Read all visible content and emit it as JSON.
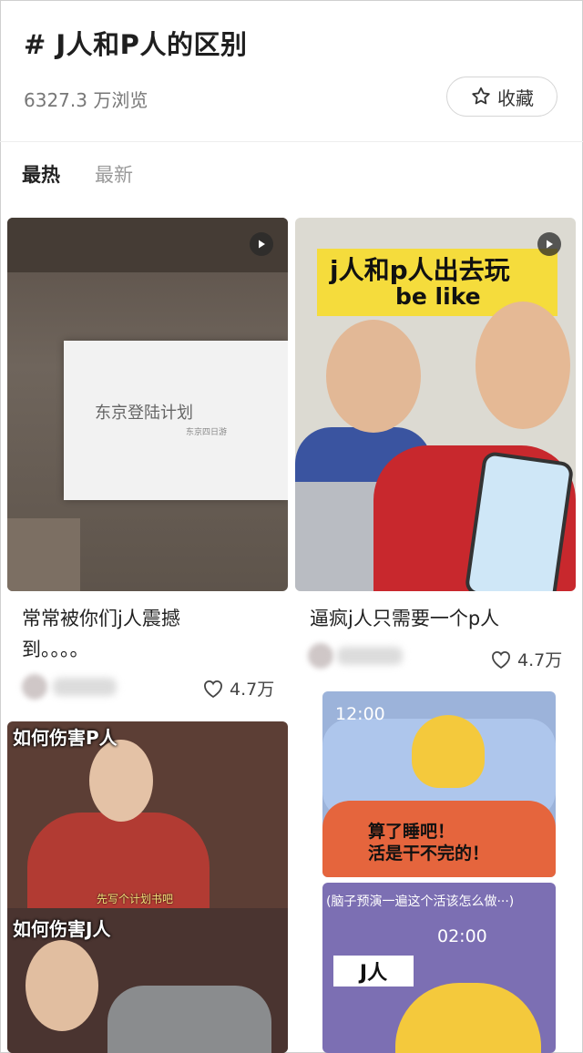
{
  "header": {
    "topic_title": "# J人和P人的区别",
    "views": "6327.3 万浏览",
    "favorite_label": "收藏"
  },
  "tabs": [
    {
      "label": "最热",
      "active": true
    },
    {
      "label": "最新",
      "active": false
    }
  ],
  "cards": [
    {
      "title": "常常被你们j人震撼到。。。。",
      "title_line1": "常常被你们j人震撼",
      "title_line2": "到。。。。",
      "likes": "4.7万",
      "media": {
        "type": "video",
        "screen_title": "东京登陆计划",
        "screen_subtitle": "东京四日游"
      }
    },
    {
      "title": "逼疯j人只需要一个p人",
      "likes": "4.7万",
      "media": {
        "type": "video",
        "banner_line1": "j人和p人出去玩",
        "banner_line2": "be like"
      }
    },
    {
      "media": {
        "type": "image",
        "caption_top": "如何伤害P人",
        "subtitle": "先写个计划书吧",
        "caption_bottom": "如何伤害J人"
      }
    },
    {
      "media": {
        "type": "image",
        "time": "12:00",
        "speech": [
          "算了睡吧！",
          "活是干不完的！"
        ]
      }
    },
    {
      "media": {
        "type": "image",
        "top_text": "(脑子预演一遍这个活该怎么做···)",
        "time": "02:00",
        "tag": "J人"
      }
    }
  ]
}
